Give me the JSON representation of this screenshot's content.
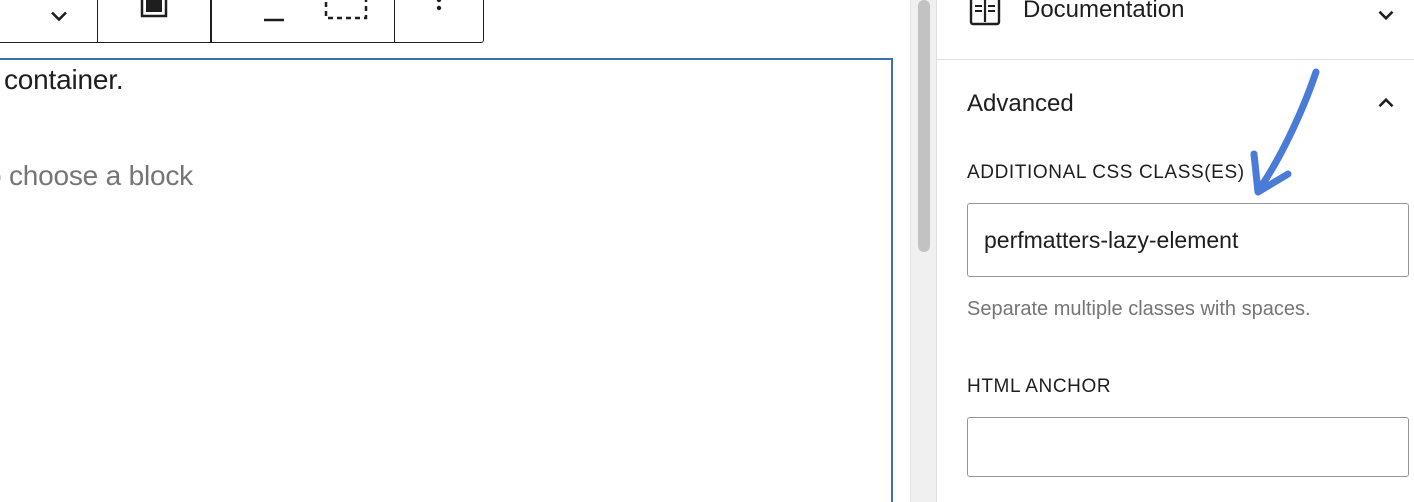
{
  "toolbar": {
    "buttons": [
      {
        "icon": "chevron-down-icon"
      },
      {
        "icon": "full-width-icon"
      },
      {
        "icon": "justify-space-between-icon"
      },
      {
        "icon": "more-options-icon"
      }
    ]
  },
  "editor": {
    "block_text": "container.",
    "block_placeholder": "o choose a block"
  },
  "sidebar": {
    "documentation": {
      "label": "Documentation",
      "icon": "documentation-icon",
      "expanded": false
    },
    "advanced": {
      "label": "Advanced",
      "expanded": true,
      "css_classes": {
        "label": "ADDITIONAL CSS CLASS(ES)",
        "value": "perfmatters-lazy-element",
        "help": "Separate multiple classes with spaces."
      },
      "html_anchor": {
        "label": "HTML ANCHOR",
        "value": ""
      }
    }
  },
  "annotation": {
    "arrow_color": "#4a7bd8"
  },
  "colors": {
    "block_border": "#3d6fa8",
    "text_primary": "#1e1e1e",
    "text_muted": "#757575",
    "input_border": "#949494"
  }
}
